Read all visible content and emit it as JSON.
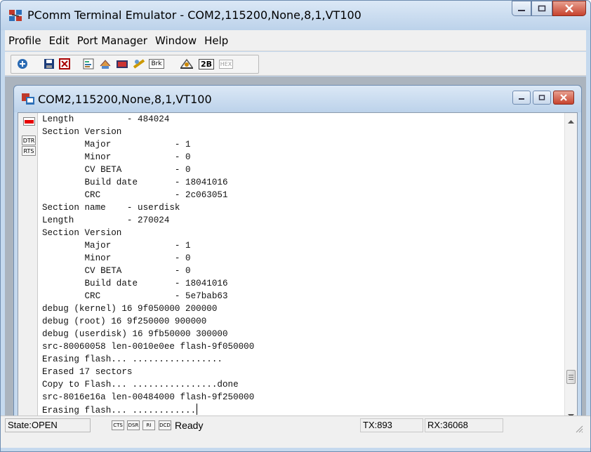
{
  "window": {
    "title": "PComm Terminal Emulator - COM2,115200,None,8,1,VT100"
  },
  "menu": [
    "Profile",
    "Edit",
    "Port Manager",
    "Window",
    "Help"
  ],
  "toolbar": {
    "brk_label": "Brk",
    "twob_label": "2B",
    "hex_label": "HEX"
  },
  "child": {
    "title": "COM2,115200,None,8,1,VT100"
  },
  "sidebar": {
    "dtr": "DTR",
    "rts": "RTS"
  },
  "terminal_lines": [
    "Length          - 484024",
    "Section Version",
    "        Major            - 1",
    "        Minor            - 0",
    "        CV BETA          - 0",
    "        Build date       - 18041016",
    "        CRC              - 2c063051",
    "Section name    - userdisk",
    "Length          - 270024",
    "Section Version",
    "        Major            - 1",
    "        Minor            - 0",
    "        CV BETA          - 0",
    "        Build date       - 18041016",
    "        CRC              - 5e7bab63",
    "debug (kernel) 16 9f050000 200000",
    "debug (root) 16 9f250000 900000",
    "debug (userdisk) 16 9fb50000 300000",
    "src-80060058 len-0010e0ee flash-9f050000",
    "Erasing flash... .................",
    "Erased 17 sectors",
    "Copy to Flash... ................done",
    "src-8016e16a len-00484000 flash-9f250000",
    "Erasing flash... ............"
  ],
  "status": {
    "state": "State:OPEN",
    "cts": "CTS",
    "dsr": "DSR",
    "ri": "RI",
    "dcd": "DCD",
    "ready": "Ready",
    "tx": "TX:893",
    "rx": "RX:36068"
  },
  "colors": {
    "titlebar": "#c5d9ee",
    "close_button": "#c7432e",
    "mdi_background": "#abb4be",
    "led_red": "#e60000"
  }
}
